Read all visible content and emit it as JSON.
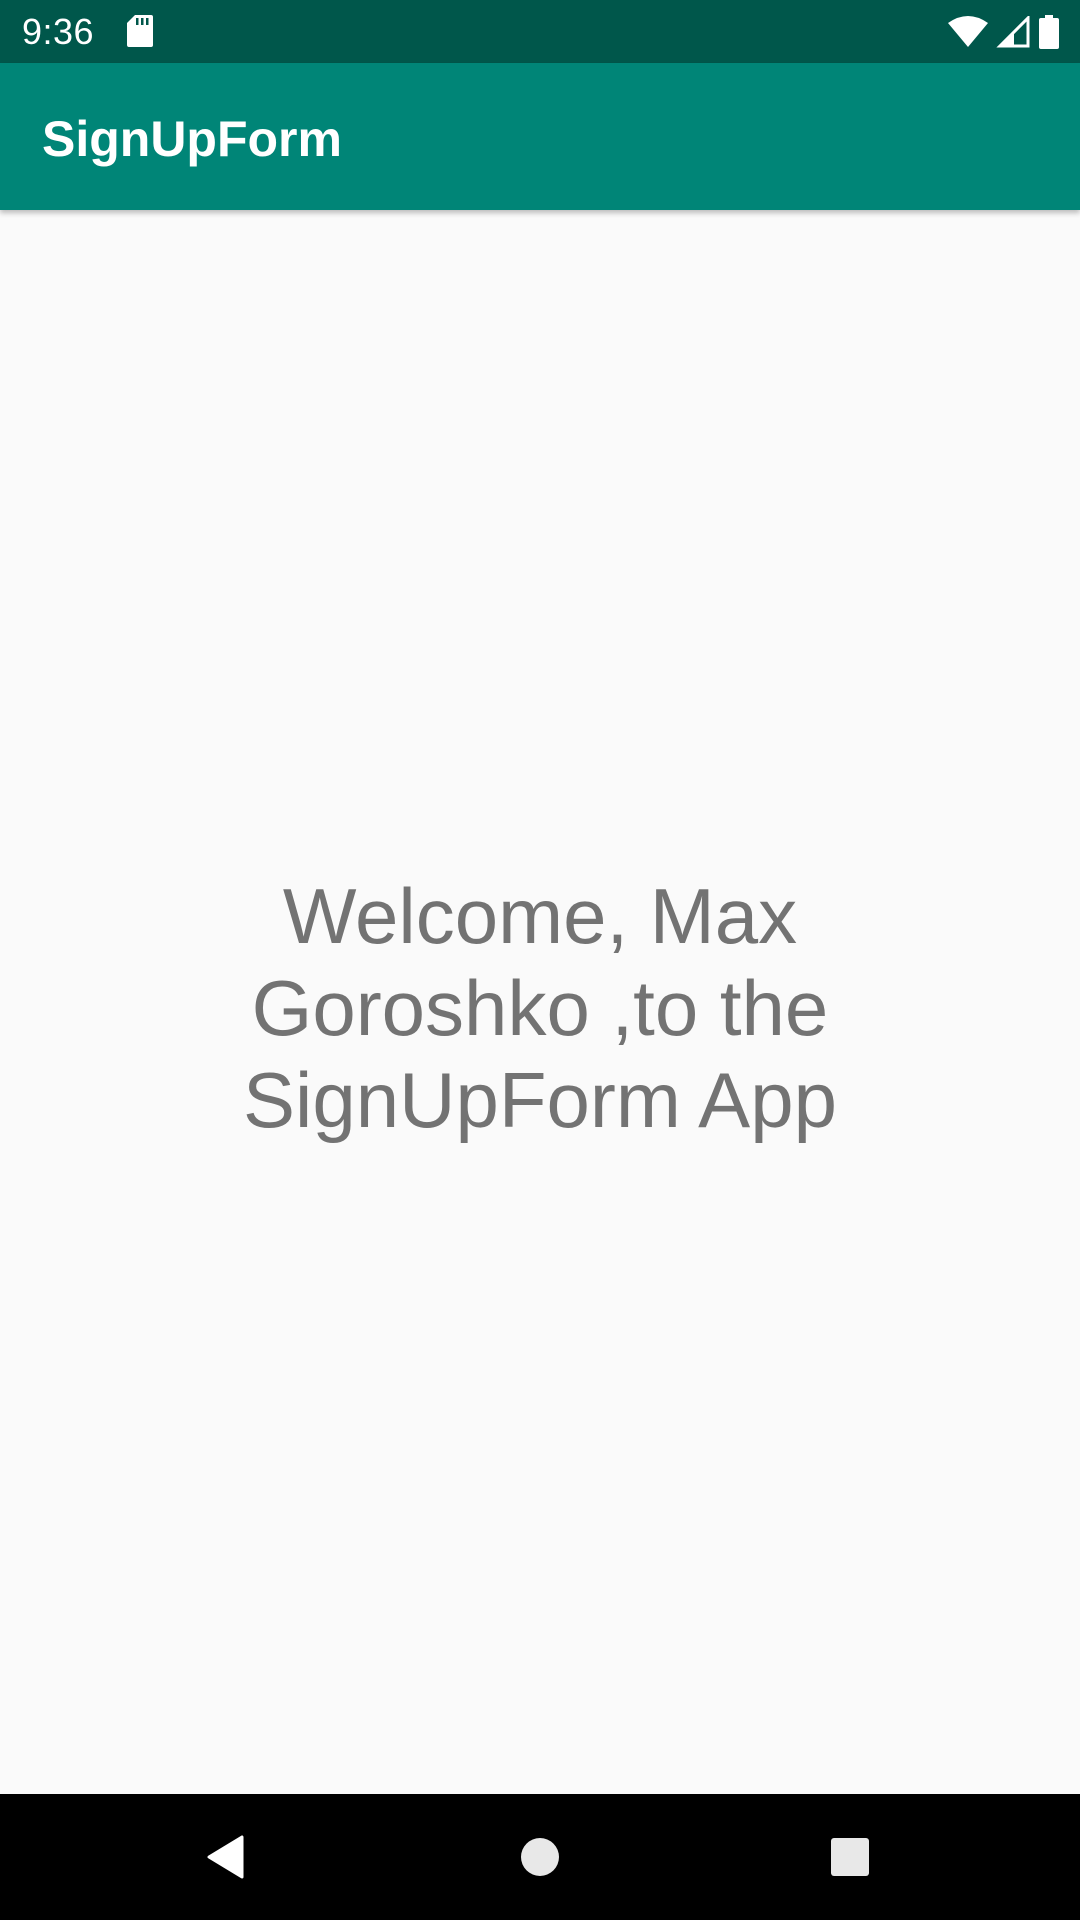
{
  "status_bar": {
    "time": "9:36",
    "icons": [
      "sd-card-icon",
      "wifi-icon",
      "signal-icon",
      "battery-icon"
    ]
  },
  "app_bar": {
    "title": "SignUpForm"
  },
  "main": {
    "welcome_message": "Welcome, Max Goroshko ,to the SignUpForm App"
  },
  "nav_bar": {
    "buttons": [
      "back-button",
      "home-button",
      "recents-button"
    ]
  },
  "colors": {
    "status_bar": "#00574b",
    "app_bar": "#008577",
    "background": "#fafafa",
    "text": "#737373",
    "nav_bar": "#000000"
  }
}
